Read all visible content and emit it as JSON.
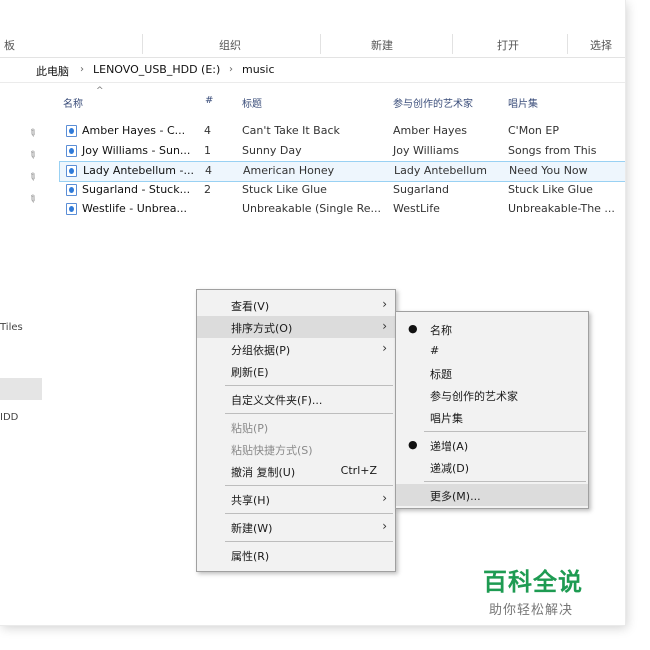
{
  "ribbon": {
    "items": [
      "板",
      "组织",
      "新建",
      "打开",
      "选择"
    ]
  },
  "address": {
    "crumbs": [
      "此电脑",
      "LENOVO_USB_HDD (E:)",
      "music"
    ]
  },
  "columns": [
    "名称",
    "#",
    "标题",
    "参与创作的艺术家",
    "唱片集"
  ],
  "rows": [
    {
      "name": "Amber Hayes - C...",
      "num": "4",
      "title": "Can't Take It Back",
      "artist": "Amber Hayes",
      "album": "C'Mon EP"
    },
    {
      "name": "Joy Williams - Sun...",
      "num": "1",
      "title": "Sunny Day",
      "artist": "Joy Williams",
      "album": "Songs from This"
    },
    {
      "name": "Lady Antebellum -...",
      "num": "4",
      "title": "American Honey",
      "artist": "Lady Antebellum",
      "album": "Need You Now"
    },
    {
      "name": "Sugarland - Stuck...",
      "num": "2",
      "title": "Stuck Like Glue",
      "artist": "Sugarland",
      "album": "Stuck Like Glue"
    },
    {
      "name": "Westlife - Unbrea...",
      "num": "",
      "title": "Unbreakable (Single Re...",
      "artist": "WestLife",
      "album": "Unbreakable-The ..."
    }
  ],
  "left_fragments": [
    "Tiles",
    "IDD"
  ],
  "context_menu": {
    "view": "查看(V)",
    "sort": "排序方式(O)",
    "group": "分组依据(P)",
    "refresh": "刷新(E)",
    "customize": "自定义文件夹(F)...",
    "paste": "粘贴(P)",
    "paste_shortcut": "粘贴快捷方式(S)",
    "undo": "撤消 复制(U)",
    "undo_shortcut": "Ctrl+Z",
    "share": "共享(H)",
    "new": "新建(W)",
    "properties": "属性(R)"
  },
  "submenu": {
    "name": "名称",
    "number": "#",
    "title": "标题",
    "artist": "参与创作的艺术家",
    "album": "唱片集",
    "ascending": "递增(A)",
    "descending": "递减(D)",
    "more": "更多(M)..."
  },
  "watermark": {
    "title": "百科全说",
    "subtitle": "助你轻松解决"
  }
}
